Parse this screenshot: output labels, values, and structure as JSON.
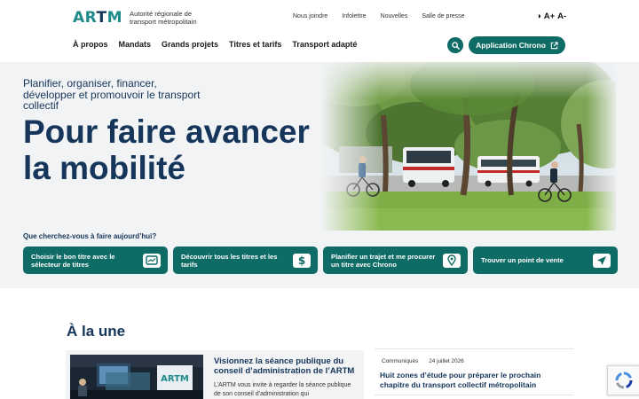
{
  "header": {
    "logo_mark": "ARTM",
    "logo_sub": "Autorité régionale de transport métropolitain",
    "util_links": [
      "Nous joindre",
      "Infolettre",
      "Nouvelles",
      "Salle de presse"
    ],
    "accessibility": {
      "contrast": "◑",
      "increase": "A+",
      "decrease": "A-"
    },
    "nav": [
      "À propos",
      "Mandats",
      "Grands projets",
      "Titres et tarifs",
      "Transport adapté"
    ],
    "chrono_button": "Application Chrono"
  },
  "hero": {
    "subtitle": "Planifier, organiser, financer, développer et promouvoir le transport collectif",
    "title": "Pour faire avancer la mobilité",
    "question": "Que cherchez-vous à faire aujourd’hui?",
    "quick_links": [
      {
        "label": "Choisir le bon titre avec le sélecteur de titres",
        "icon": "card-icon"
      },
      {
        "label": "Découvrir tous les titres et les tarifs",
        "icon": "dollar-icon"
      },
      {
        "label": "Planifier un trajet et me procurer un titre avec Chrono",
        "icon": "map-pin-icon"
      },
      {
        "label": "Trouver un point de vente",
        "icon": "send-icon"
      }
    ]
  },
  "news": {
    "section_title": "À la une",
    "feature": {
      "title": "Visionnez la séance publique du conseil d’administration de l’ARTM",
      "text": "L’ARTM vous invite à regarder la séance publique de son conseil d’administration qui"
    },
    "items": [
      {
        "category": "Communiqués",
        "date": "24 juillet 2026",
        "title": "Huit zones d’étude pour préparer le prochain chapitre du transport collectif métropolitain"
      }
    ]
  },
  "colors": {
    "primary": "#0f6b65",
    "navy": "#15355a",
    "teal": "#1e8a8a",
    "hero_bg": "#f1f3f4"
  }
}
